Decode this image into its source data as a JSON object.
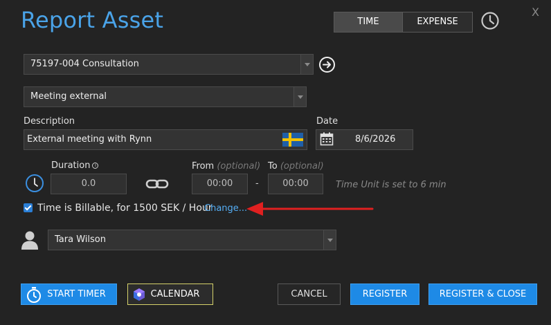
{
  "window": {
    "title": "Report Asset",
    "close_label": "X"
  },
  "mode_toggle": {
    "time_label": "TIME",
    "expense_label": "EXPENSE",
    "active": "TIME"
  },
  "project": {
    "selected": "75197-004 Consultation"
  },
  "activity": {
    "selected": "Meeting external"
  },
  "description": {
    "label": "Description",
    "value": "External meeting with Rynn"
  },
  "date": {
    "label": "Date",
    "value": "8/6/2026"
  },
  "duration": {
    "label": "Duration",
    "value": "0.0"
  },
  "from": {
    "label": "From",
    "optional": "(optional)",
    "value": "00:00"
  },
  "to": {
    "label": "To",
    "optional": "(optional)",
    "value": "00:00"
  },
  "time_unit_hint": "Time Unit is set to 6 min",
  "billable": {
    "checked": true,
    "text": "Time is Billable, for 1500 SEK / Hour",
    "change_label": "Change..."
  },
  "user": {
    "selected": "Tara Wilson"
  },
  "buttons": {
    "start_timer": "START TIMER",
    "calendar": "CALENDAR",
    "cancel": "CANCEL",
    "register": "REGISTER",
    "register_close": "REGISTER & CLOSE"
  },
  "colors": {
    "background": "#232323",
    "accent": "#1e8ae6",
    "title": "#4aa3e8",
    "annotation_arrow": "#e02020"
  }
}
